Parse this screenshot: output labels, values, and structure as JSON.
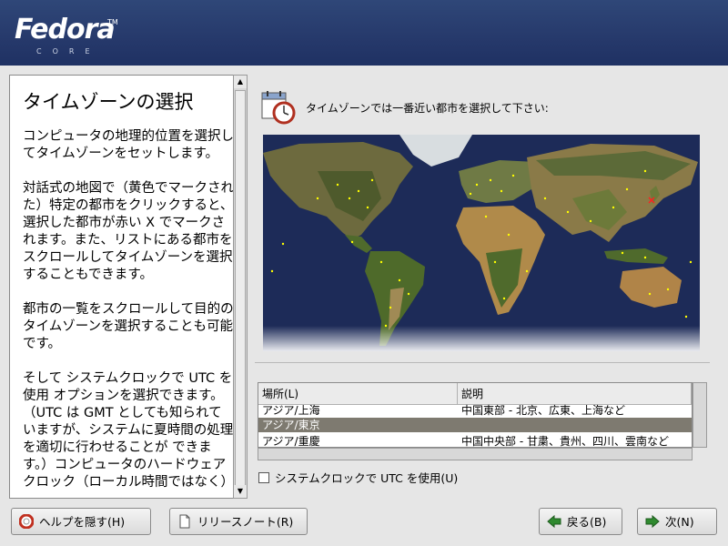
{
  "branding": {
    "logo": "Fedora",
    "trademark": "TM",
    "subtitle": "CORE"
  },
  "help": {
    "title": "タイムゾーンの選択",
    "paragraphs": [
      "コンピュータの地理的位置を選択してタイムゾーンをセットします。",
      "対話式の地図で（黄色でマークされた）特定の都市をクリックすると、選択した都市が赤い X でマークされます。また、リストにある都市をスクロールしてタイムゾーンを選択することもできます。",
      "都市の一覧をスクロールして目的のタイムゾーンを選択することも可能です。",
      "そして システムクロックで UTC を使用 オプションを選択できます。（UTC は GMT としても知られていますが、システムに夏時間の処理を適切に行わせることが できます。）コンピュータのハードウェアクロック（ローカル時間ではなく）"
    ]
  },
  "main": {
    "prompt": "タイムゾーンでは一番近い都市を選択して下さい:",
    "icon": "clock-calendar-icon"
  },
  "timezone_list": {
    "columns": [
      "場所(L)",
      "説明"
    ],
    "rows": [
      {
        "location": "アジア/上海",
        "description": "中国東部 - 北京、広東、上海など",
        "selected": false
      },
      {
        "location": "アジア/東京",
        "description": "",
        "selected": true
      },
      {
        "location": "アジア/重慶",
        "description": "中国中央部 - 甘粛、貴州、四川、雲南など",
        "selected": false
      }
    ]
  },
  "utc_checkbox": {
    "label": "システムクロックで UTC を使用(U)",
    "checked": false
  },
  "buttons": {
    "hide_help": "ヘルプを隠す(H)",
    "release_notes": "リリースノート(R)",
    "back": "戻る(B)",
    "next": "次(N)"
  },
  "colors": {
    "banner": "#26396b",
    "selection": "#7e7a70",
    "city_marker": "#ffff00",
    "selected_marker": "#ff0000"
  }
}
